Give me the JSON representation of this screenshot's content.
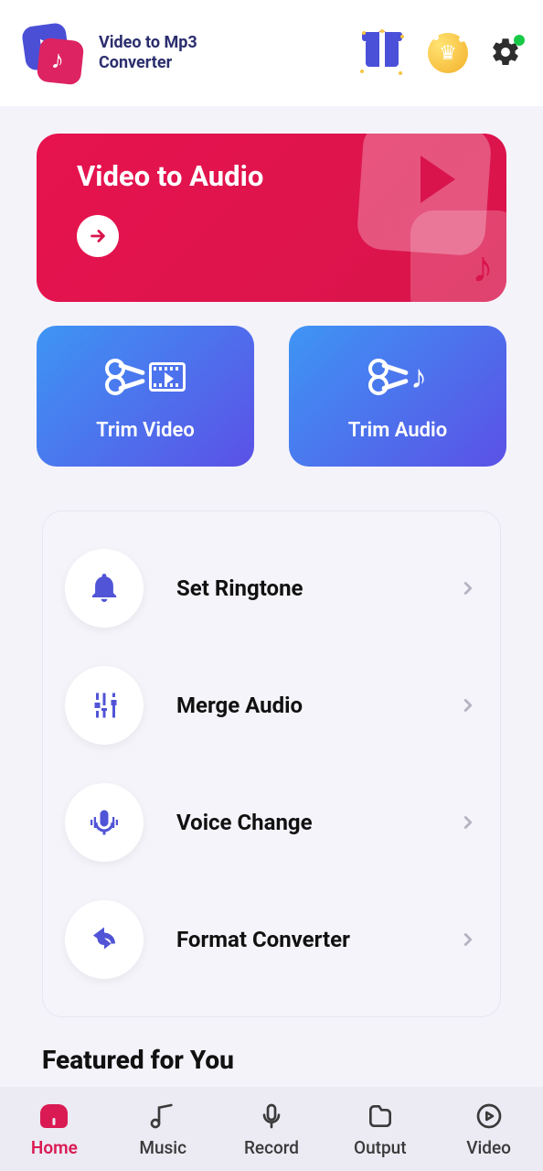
{
  "header": {
    "app_title": "Video to Mp3\nConverter"
  },
  "hero": {
    "title": "Video to Audio"
  },
  "trim": {
    "video_label": "Trim Video",
    "audio_label": "Trim Audio"
  },
  "features": {
    "ringtone": "Set Ringtone",
    "merge": "Merge Audio",
    "voice": "Voice Change",
    "format": "Format Converter"
  },
  "section": {
    "featured_title": "Featured for You"
  },
  "nav": {
    "home": "Home",
    "music": "Music",
    "record": "Record",
    "output": "Output",
    "video": "Video"
  }
}
